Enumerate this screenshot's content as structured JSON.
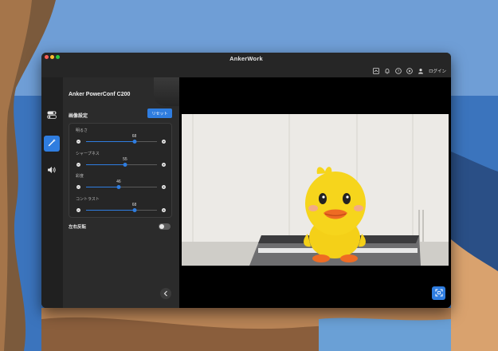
{
  "window": {
    "title": "AnkerWork"
  },
  "titlebar": {
    "icons": [
      "firmware-icon",
      "bell-icon",
      "help-icon",
      "play-icon",
      "user-icon"
    ],
    "login_label": "ログイン"
  },
  "nav": {
    "items": [
      {
        "icon": "toggles-icon",
        "active": false
      },
      {
        "icon": "magic-wand-icon",
        "active": true
      },
      {
        "icon": "speaker-icon",
        "active": false
      }
    ]
  },
  "panel": {
    "device_name": "Anker PowerConf C200",
    "section_title": "画像設定",
    "reset_label": "リセット",
    "sliders": [
      {
        "label": "明るさ",
        "value": 68,
        "max": 100
      },
      {
        "label": "シャープネス",
        "value": 55,
        "max": 100
      },
      {
        "label": "彩度",
        "value": 46,
        "max": 100
      },
      {
        "label": "コントラスト",
        "value": 68,
        "max": 100
      }
    ],
    "flip_label": "左右反転",
    "flip_on": false
  },
  "colors": {
    "accent": "#2f7de0",
    "window_bg": "#1f1f1f",
    "panel_bg": "#2b2b2b"
  }
}
